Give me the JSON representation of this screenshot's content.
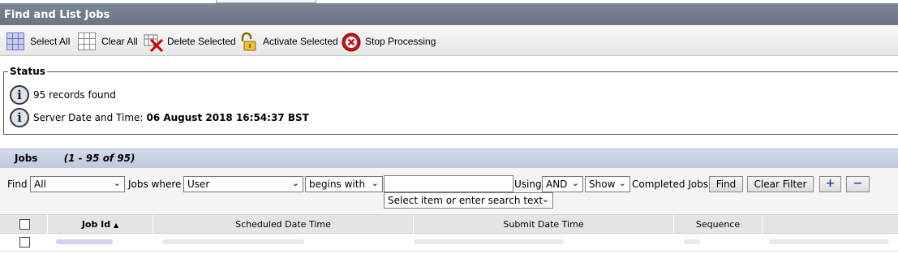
{
  "window": {
    "title": "Find and List Jobs"
  },
  "toolbar": {
    "select_all": "Select All",
    "clear_all": "Clear All",
    "delete_selected": "Delete Selected",
    "activate_selected": "Activate Selected",
    "stop_processing": "Stop Processing"
  },
  "status": {
    "legend": "Status",
    "records": "95 records found",
    "server_label": "Server Date and Time:",
    "server_value": "06 August 2018 16:54:37 BST"
  },
  "jobs": {
    "title": "Jobs",
    "count": "(1 - 95 of 95)"
  },
  "filter": {
    "find_label": "Find",
    "find_value": "All",
    "jobs_where_label": "Jobs where",
    "field_value": "User",
    "operator_value": "begins with",
    "search_value": "",
    "suggest_value": "Select item or enter search text",
    "using_label": "Using",
    "using_value": "AND",
    "show_value": "Show",
    "completed_label": "Completed Jobs",
    "find_button": "Find",
    "clear_filter_button": "Clear Filter",
    "add_glyph": "+",
    "remove_glyph": "−"
  },
  "table": {
    "columns": [
      "Job Id",
      "Scheduled Date Time",
      "Submit Date Time",
      "Sequence"
    ],
    "sort_indicator": "▲"
  },
  "icons": {
    "select_all": "grid-filled-icon",
    "clear_all": "grid-empty-icon",
    "delete": "delete-x-icon",
    "activate": "padlock-icon",
    "stop": "stop-icon",
    "info": "info-icon"
  }
}
